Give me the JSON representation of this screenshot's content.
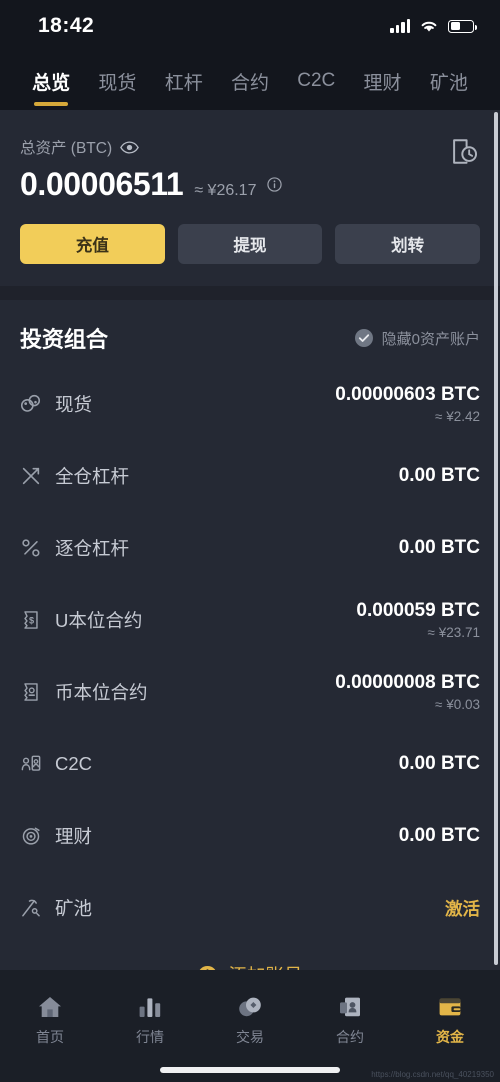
{
  "status_bar": {
    "time": "18:42",
    "signal_icon": "cellular-signal-icon",
    "wifi_icon": "wifi-icon",
    "battery_icon": "battery-icon"
  },
  "tabs": [
    {
      "label": "总览",
      "name": "tab-overview",
      "active": true
    },
    {
      "label": "现货",
      "name": "tab-spot",
      "active": false
    },
    {
      "label": "杠杆",
      "name": "tab-margin",
      "active": false
    },
    {
      "label": "合约",
      "name": "tab-futures",
      "active": false
    },
    {
      "label": "C2C",
      "name": "tab-c2c",
      "active": false
    },
    {
      "label": "理财",
      "name": "tab-earn",
      "active": false
    },
    {
      "label": "矿池",
      "name": "tab-pool",
      "active": false
    }
  ],
  "balance": {
    "label": "总资产 (BTC)",
    "amount": "0.00006511",
    "fiat": "≈ ¥26.17",
    "eye_icon": "eye-icon",
    "info_icon": "info-icon",
    "history_icon": "transaction-history-icon",
    "buttons": [
      {
        "label": "充值",
        "name": "deposit-button",
        "style": "primary"
      },
      {
        "label": "提现",
        "name": "withdraw-button",
        "style": "ghost"
      },
      {
        "label": "划转",
        "name": "transfer-button",
        "style": "ghost"
      }
    ]
  },
  "portfolio": {
    "title": "投资组合",
    "hide_zero_label": "隐藏0资产账户",
    "hide_zero_checked": true,
    "accounts": [
      {
        "name": "现货",
        "icon": "spot-icon",
        "amount": "0.00000603 BTC",
        "sub": "≈ ¥2.42",
        "action": ""
      },
      {
        "name": "全仓杠杆",
        "icon": "cross-margin-icon",
        "amount": "0.00 BTC",
        "sub": "",
        "action": ""
      },
      {
        "name": "逐仓杠杆",
        "icon": "isolated-margin-icon",
        "amount": "0.00 BTC",
        "sub": "",
        "action": ""
      },
      {
        "name": "U本位合约",
        "icon": "usdt-futures-icon",
        "amount": "0.000059 BTC",
        "sub": "≈ ¥23.71",
        "action": ""
      },
      {
        "name": "币本位合约",
        "icon": "coin-futures-icon",
        "amount": "0.00000008 BTC",
        "sub": "≈ ¥0.03",
        "action": ""
      },
      {
        "name": "C2C",
        "icon": "c2c-users-icon",
        "amount": "0.00 BTC",
        "sub": "",
        "action": ""
      },
      {
        "name": "理财",
        "icon": "earn-circle-icon",
        "amount": "0.00 BTC",
        "sub": "",
        "action": ""
      },
      {
        "name": "矿池",
        "icon": "mining-pool-icon",
        "amount": "",
        "sub": "",
        "action": "激活"
      }
    ],
    "add_account_label": "添加账号",
    "add_account_icon": "plus-circle-icon"
  },
  "bottom_nav": [
    {
      "label": "首页",
      "icon": "home-icon",
      "name": "nav-home",
      "active": false
    },
    {
      "label": "行情",
      "icon": "markets-icon",
      "name": "nav-markets",
      "active": false
    },
    {
      "label": "交易",
      "icon": "trade-icon",
      "name": "nav-trade",
      "active": false
    },
    {
      "label": "合约",
      "icon": "futures-icon",
      "name": "nav-futures",
      "active": false
    },
    {
      "label": "资金",
      "icon": "wallet-icon",
      "name": "nav-assets",
      "active": true
    }
  ],
  "watermark": "https://blog.csdn.net/qq_40219350",
  "colors": {
    "accent_gold": "#e2b548",
    "primary_button": "#f2cd59",
    "page_bg": "#252934",
    "chrome_bg": "#13161d",
    "nav_bg": "#1b1f27"
  }
}
